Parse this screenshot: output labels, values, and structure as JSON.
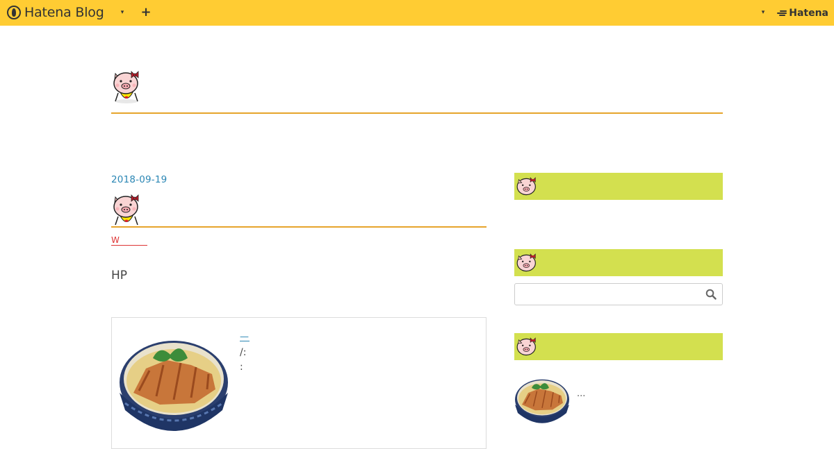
{
  "topbar": {
    "brand_label": "Hatena Blog",
    "menu_caret": "▾",
    "add_label": "+",
    "account_caret": "▾",
    "hatena_label": "Hatena",
    "background_color": "#ffcc33"
  },
  "entry": {
    "date": "2018-09-19",
    "category": "W",
    "body_text": "HP",
    "embed": {
      "title": "—",
      "line1": "/:",
      "line2": ":"
    }
  },
  "sidebar": {
    "module_color": "#d3e04f",
    "recent_ellipsis": "..."
  },
  "colors": {
    "accent_line": "#e6a42b",
    "link_blue": "#2a86b4",
    "category_red": "#dd3333"
  }
}
